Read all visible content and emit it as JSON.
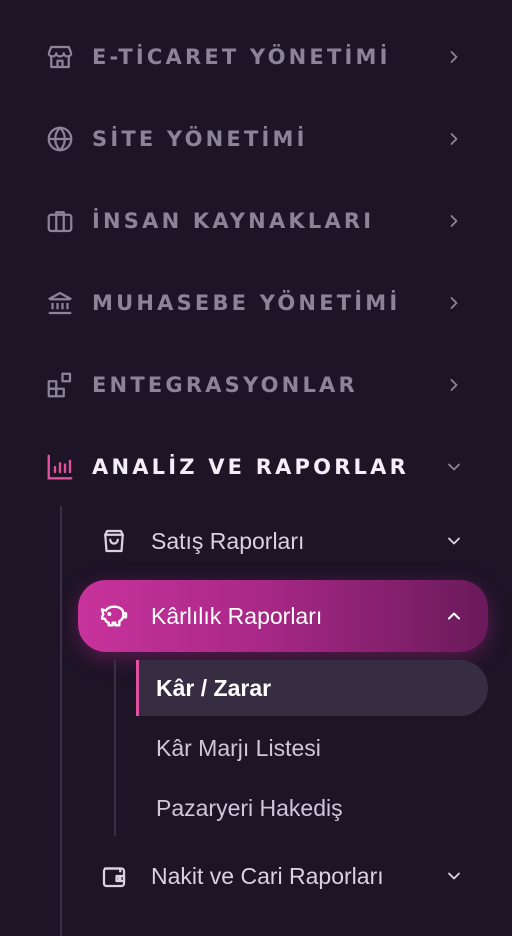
{
  "menu": {
    "items": [
      {
        "label": "E-TİCARET YÖNETİMİ",
        "icon": "store-icon"
      },
      {
        "label": "SİTE YÖNETİMİ",
        "icon": "globe-icon"
      },
      {
        "label": "İNSAN KAYNAKLARI",
        "icon": "briefcase-icon"
      },
      {
        "label": "MUHASEBE YÖNETİMİ",
        "icon": "bank-icon"
      },
      {
        "label": "ENTEGRASYONLAR",
        "icon": "blocks-icon"
      },
      {
        "label": "ANALİZ VE RAPORLAR",
        "icon": "bar-chart-icon",
        "expanded": true
      }
    ],
    "submenu": [
      {
        "label": "Satış Raporları",
        "icon": "shopping-bag-icon"
      },
      {
        "label": "Kârlılık Raporları",
        "icon": "piggy-bank-icon",
        "expanded": true,
        "children": [
          {
            "label": "Kâr / Zarar",
            "active": true
          },
          {
            "label": "Kâr Marjı Listesi"
          },
          {
            "label": "Pazaryeri Hakediş"
          }
        ]
      },
      {
        "label": "Nakit ve Cari Raporları",
        "icon": "wallet-icon"
      }
    ]
  },
  "colors": {
    "background": "#1d1426",
    "accent": "#c8339c",
    "muted_text": "#8b8396",
    "active_leaf_bg": "#372d42"
  }
}
